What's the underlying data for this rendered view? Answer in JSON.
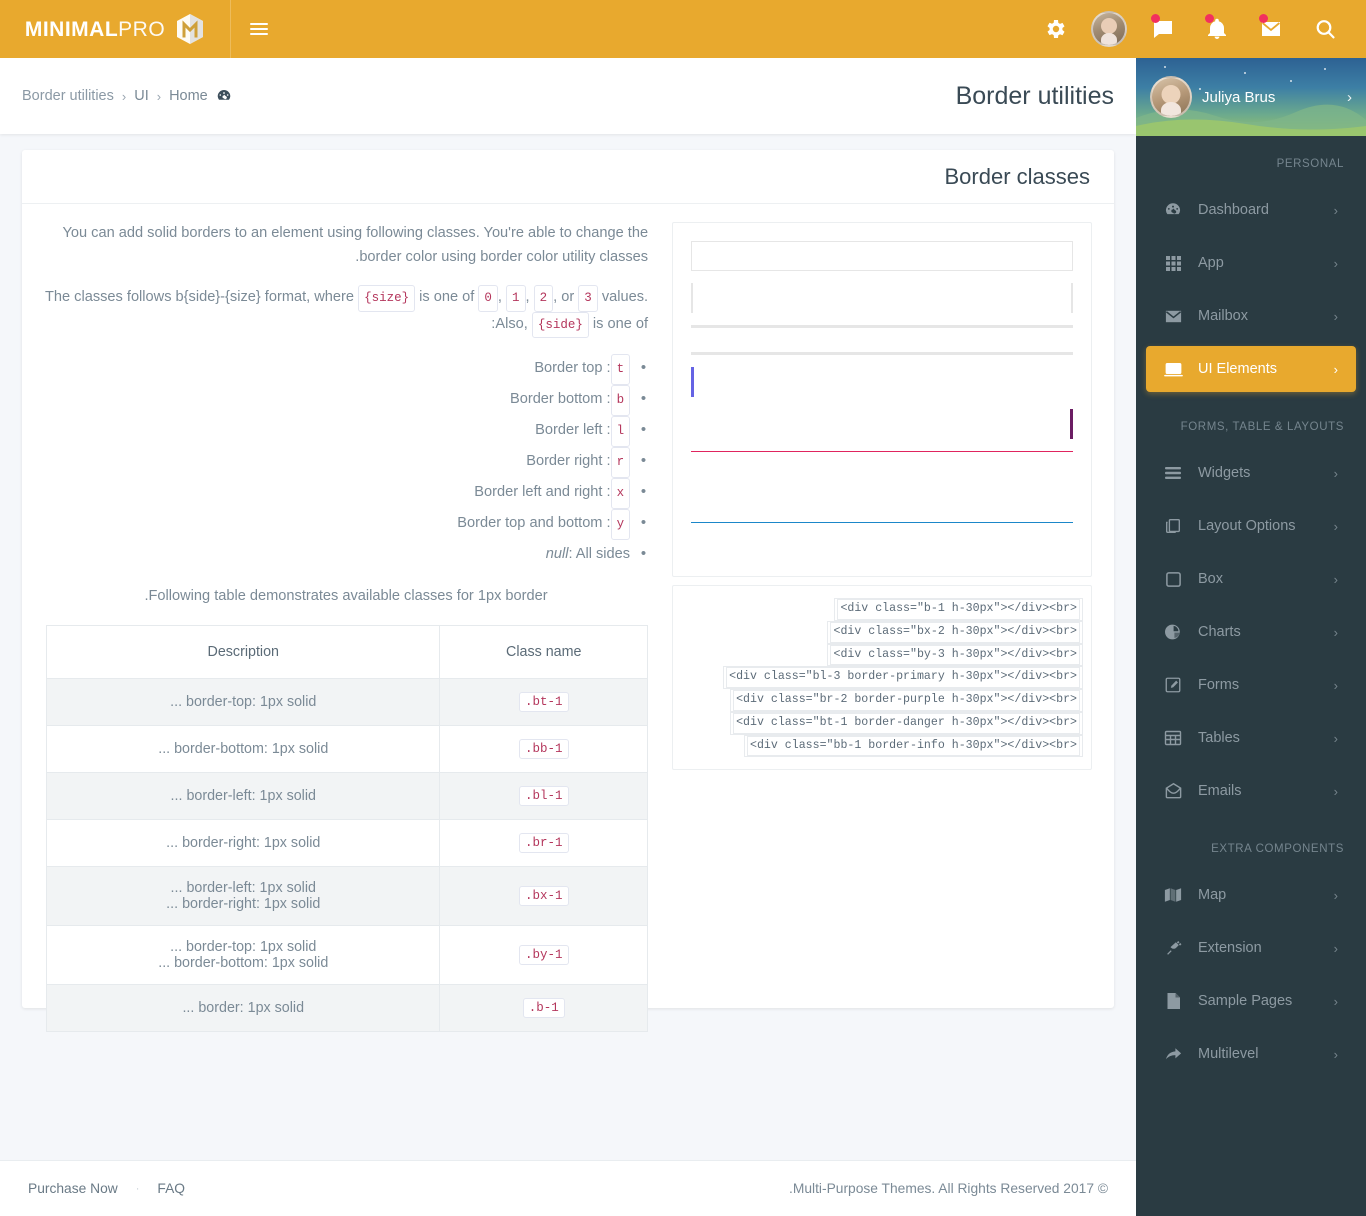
{
  "brand": {
    "bold": "MINIMAL",
    "light": "PRO",
    "logo_icon": "minimalpro-logo-icon"
  },
  "topbar": {
    "bg_color": "#e8a92e",
    "hamburger_icon": "hamburger-menu-icon",
    "items": [
      {
        "icon": "gear-icon",
        "name": "settings",
        "badge": false
      },
      {
        "icon": "avatar",
        "name": "user-avatar",
        "badge": false
      },
      {
        "icon": "chat-icon",
        "name": "messages",
        "badge": true
      },
      {
        "icon": "bell-icon",
        "name": "notifications",
        "badge": true
      },
      {
        "icon": "envelope-icon",
        "name": "mail",
        "badge": true
      },
      {
        "icon": "search-icon",
        "name": "search",
        "badge": false
      }
    ]
  },
  "pagehead": {
    "title": "Border utilities",
    "breadcrumb": [
      {
        "label": "Border utilities"
      },
      {
        "label": "UI"
      },
      {
        "label": "Home"
      }
    ],
    "breadcrumb_sep": "‹",
    "home_icon": "dashboard-icon"
  },
  "sidebar": {
    "bg_color": "#2a3b42",
    "active_color": "#e8a92e",
    "profile": {
      "name": "Juliya Brus",
      "collapse_icon": "chevron-left-icon",
      "avatar": "user-avatar"
    },
    "sections": [
      {
        "label": "PERSONAL",
        "items": [
          {
            "label": "Dashboard",
            "icon": "dashboard-icon",
            "active": false
          },
          {
            "label": "App",
            "icon": "grid-icon",
            "active": false
          },
          {
            "label": "Mailbox",
            "icon": "envelope-icon",
            "active": false
          },
          {
            "label": "UI Elements",
            "icon": "monitor-icon",
            "active": true
          }
        ]
      },
      {
        "label": "FORMS, TABLE & LAYOUTS",
        "items": [
          {
            "label": "Widgets",
            "icon": "list-icon",
            "active": false
          },
          {
            "label": "Layout Options",
            "icon": "copy-icon",
            "active": false
          },
          {
            "label": "Box",
            "icon": "square-icon",
            "active": false
          },
          {
            "label": "Charts",
            "icon": "pie-chart-icon",
            "active": false
          },
          {
            "label": "Forms",
            "icon": "edit-icon",
            "active": false
          },
          {
            "label": "Tables",
            "icon": "table-icon",
            "active": false
          },
          {
            "label": "Emails",
            "icon": "open-envelope-icon",
            "active": false
          }
        ]
      },
      {
        "label": "EXTRA COMPONENTS",
        "items": [
          {
            "label": "Map",
            "icon": "map-icon",
            "active": false
          },
          {
            "label": "Extension",
            "icon": "plug-icon",
            "active": false
          },
          {
            "label": "Sample Pages",
            "icon": "file-icon",
            "active": false
          },
          {
            "label": "Multilevel",
            "icon": "share-arrow-icon",
            "active": false
          }
        ]
      }
    ],
    "item_arrow": "‹"
  },
  "card": {
    "title": "Border classes",
    "intro_1_a": "You can add solid borders to an element using following classes. You're able to change the border color using ",
    "intro_1_link": "border color utility classes",
    "intro_1_b": ".",
    "intro_2_a": "The classes follows b{side}-{size} format, where ",
    "code_size": "{size}",
    "intro_2_b": " is one of ",
    "sizes": [
      "0",
      "1",
      "2",
      "3"
    ],
    "intro_2_c": " values. Also, ",
    "code_side": "{side}",
    "intro_2_d": " is one of:",
    "sides": [
      {
        "code": "t",
        "desc": ": Border top"
      },
      {
        "code": "b",
        "desc": ": Border bottom"
      },
      {
        "code": "l",
        "desc": ": Border left"
      },
      {
        "code": "r",
        "desc": ": Border right"
      },
      {
        "code": "x",
        "desc": ": Border left and right"
      },
      {
        "code": "y",
        "desc": ": Border top and bottom"
      },
      {
        "code": "null",
        "desc": ": All sides",
        "italic": true
      }
    ],
    "table_caption": "Following table demonstrates available classes for 1px border.",
    "table": {
      "headers": [
        "Class name",
        "Description"
      ],
      "rows": [
        {
          "cls": ".bt-1",
          "desc": "border-top: 1px solid ..."
        },
        {
          "cls": ".bb-1",
          "desc": "border-bottom: 1px solid ..."
        },
        {
          "cls": ".bl-1",
          "desc": "border-left: 1px solid ..."
        },
        {
          "cls": ".br-1",
          "desc": "border-right: 1px solid ..."
        },
        {
          "cls": ".bx-1",
          "desc": "border-left: 1px solid ...\nborder-right: 1px solid ..."
        },
        {
          "cls": ".by-1",
          "desc": "border-top: 1px solid ...\nborder-bottom: 1px solid ..."
        },
        {
          "cls": ".b-1",
          "desc": "border: 1px solid ..."
        }
      ]
    },
    "preview_code_lines": [
      "<div class=\"b-1 h-30px\"></div><br>",
      "<div class=\"bx-2 h-30px\"></div><br>",
      "<div class=\"by-3 h-30px\"></div><br>",
      "<div class=\"bl-3 border-primary h-30px\"></div><br>",
      "<div class=\"br-2 border-purple h-30px\"></div><br>",
      "<div class=\"bt-1 border-danger h-30px\"></div><br>",
      "<div class=\"bb-1 border-info h-30px\"></div><br>"
    ],
    "preview_colors": {
      "neutral": "#e6e6e6",
      "primary": "#6563e4",
      "purple": "#6b1d63",
      "danger": "#e0245e",
      "info": "#1b87c9"
    }
  },
  "footer": {
    "links": [
      "Purchase Now",
      "FAQ"
    ],
    "bullet": "·",
    "copyright": "© 2017 Multi-Purpose Themes. All Rights Reserved."
  }
}
